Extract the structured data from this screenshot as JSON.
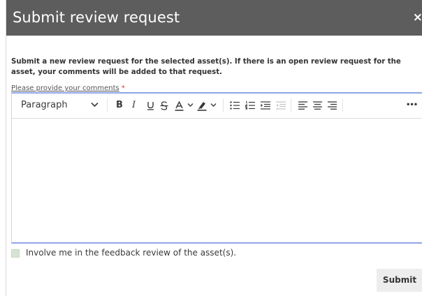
{
  "dialog": {
    "title": "Submit review request",
    "close_label": "×",
    "description": "Submit a new review request for the selected asset(s). If there is an open review request for the asset, your comments will be added to that request.",
    "comments_label": "Please provide your comments",
    "required_marker": "*",
    "editor": {
      "block_format": "Paragraph",
      "bold": "B",
      "italic": "I",
      "more": "•••",
      "content": ""
    },
    "involve_label": "Involve me in the feedback review of the asset(s).",
    "involve_checked": false,
    "submit_label": "Submit"
  },
  "colors": {
    "titlebar": "#5d5d5d",
    "editor_border": "#8fa5e8",
    "required": "#d0342c",
    "checkbox": "#d6e4d2"
  }
}
